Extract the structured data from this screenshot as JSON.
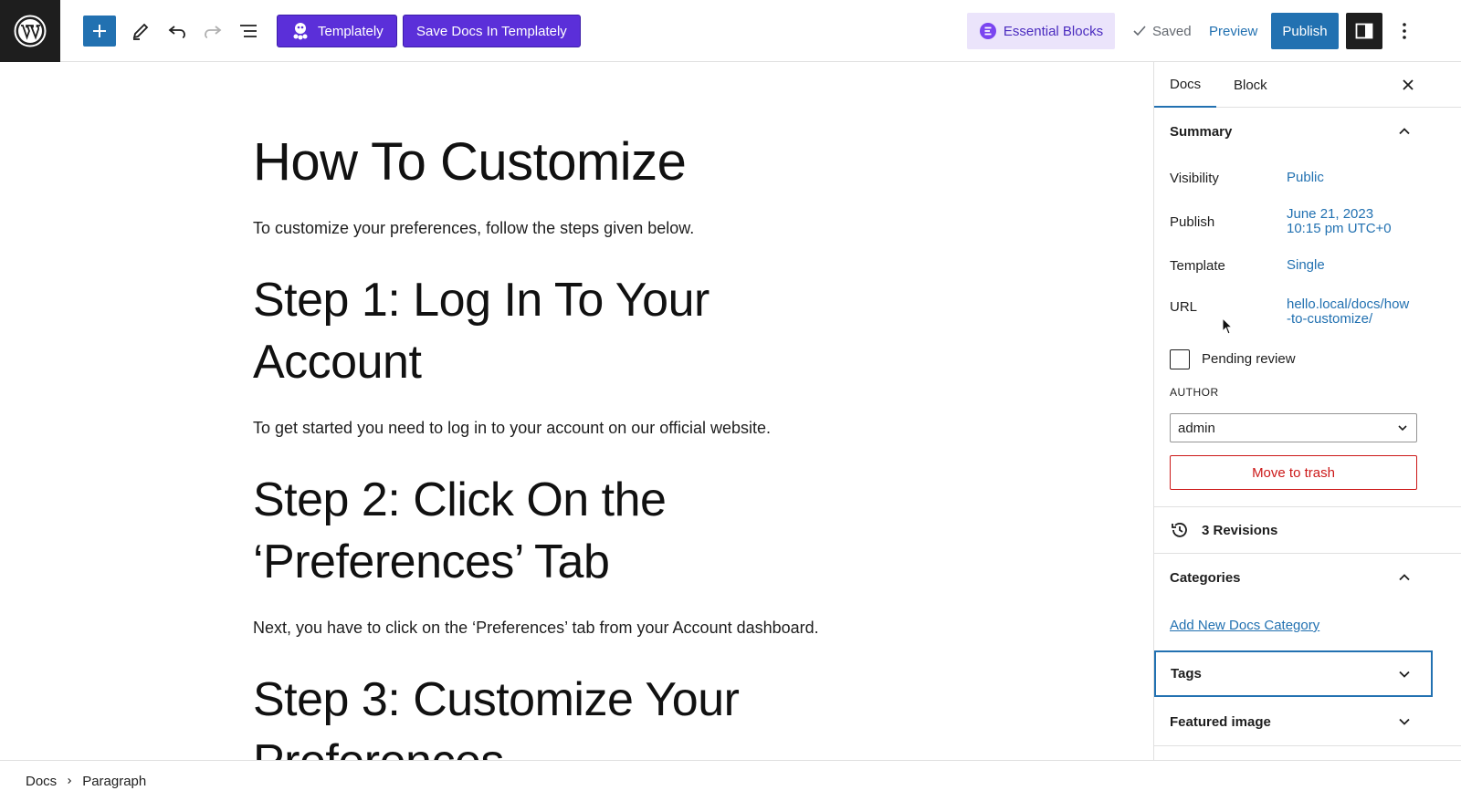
{
  "toolbar": {
    "templately_label": "Templately",
    "save_docs_label": "Save Docs In Templately",
    "essential_blocks_label": "Essential Blocks",
    "saved_label": "Saved",
    "preview_label": "Preview",
    "publish_label": "Publish"
  },
  "content": {
    "title": "How To Customize",
    "intro": "To customize your preferences, follow the steps given below.",
    "step1_heading_line1": "Step 1: Log In To Your",
    "step1_heading_line2": "Account",
    "step1_text": "To get started you need to log in to your account on our official website.",
    "step2_heading_line1": "Step 2: Click On the",
    "step2_heading_line2": "‘Preferences’ Tab",
    "step2_text": "Next, you have to click on the ‘Preferences’ tab from your Account dashboard.",
    "step3_heading_line1": "Step 3: Customize Your",
    "step3_heading_line2": "Preferences"
  },
  "sidebar": {
    "tabs": [
      {
        "label": "Docs",
        "active": true
      },
      {
        "label": "Block",
        "active": false
      }
    ],
    "summary": {
      "title": "Summary",
      "visibility_label": "Visibility",
      "visibility_value": "Public",
      "publish_label": "Publish",
      "publish_date": "June 21, 2023",
      "publish_time": "10:15 pm UTC+0",
      "template_label": "Template",
      "template_value": "Single",
      "url_label": "URL",
      "url_line1": "hello.local/docs/how",
      "url_line2": "-to-customize/",
      "pending_review_label": "Pending review",
      "pending_review_checked": false,
      "author_label": "AUTHOR",
      "author_value": "admin",
      "trash_label": "Move to trash"
    },
    "revisions_label": "3 Revisions",
    "categories": {
      "title": "Categories",
      "add_link": "Add New Docs Category"
    },
    "tags_title": "Tags",
    "featured_image_title": "Featured image"
  },
  "footer": {
    "breadcrumbs": [
      "Docs",
      "Paragraph"
    ]
  },
  "colors": {
    "accent": "#2271b1",
    "templately_purple": "#5b2fd9",
    "essential_blocks_bg": "#ebe4fb",
    "danger": "#cc1818",
    "dark": "#1e1e1e"
  }
}
